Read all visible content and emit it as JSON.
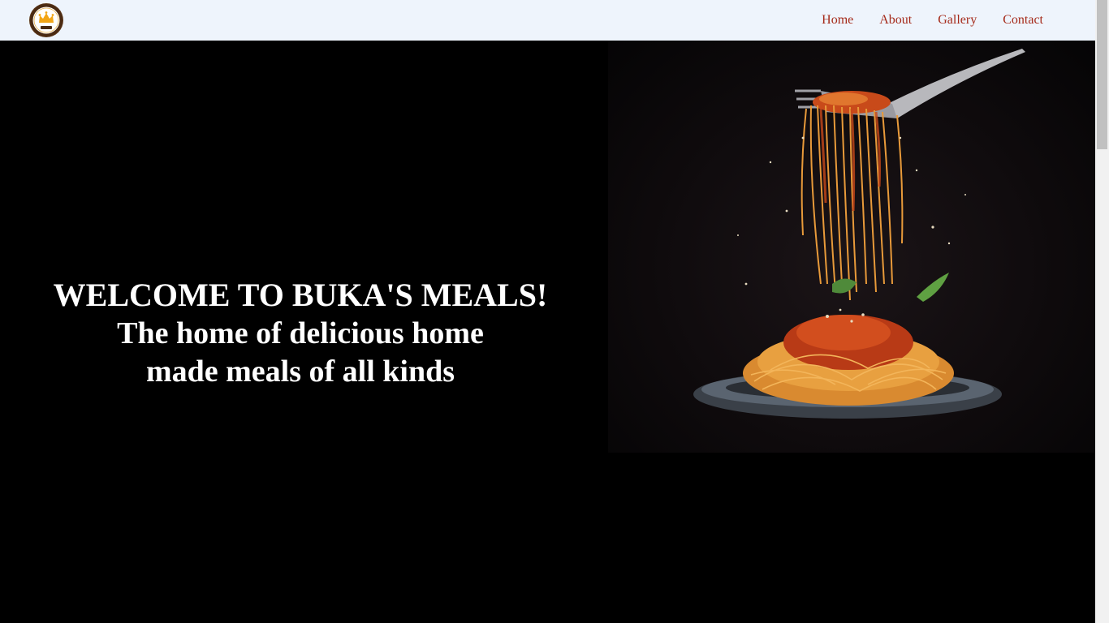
{
  "navbar": {
    "logo_icon": "crown-logo-icon",
    "links": [
      {
        "label": "Home"
      },
      {
        "label": "About"
      },
      {
        "label": "Gallery"
      },
      {
        "label": "Contact"
      }
    ],
    "link_color": "#a52a1a",
    "background": "#eef4fc"
  },
  "hero": {
    "title": "WELCOME TO BUKA'S MEALS!",
    "subtitle": "The home of delicious home made meals of all kinds",
    "image_icon": "spaghetti-fork-photo",
    "background": "#000000"
  }
}
